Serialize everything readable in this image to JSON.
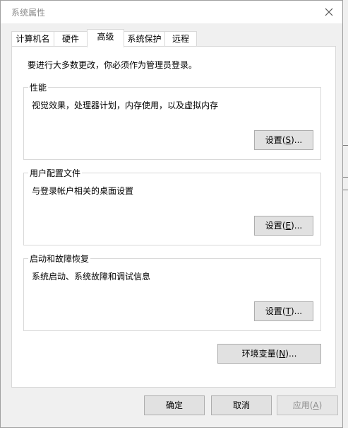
{
  "window": {
    "title": "系统属性"
  },
  "tabs": [
    {
      "label": "计算机名"
    },
    {
      "label": "硬件"
    },
    {
      "label": "高级"
    },
    {
      "label": "系统保护"
    },
    {
      "label": "远程"
    }
  ],
  "active_tab": "高级",
  "notice": "要进行大多数更改，你必须作为管理员登录。",
  "groups": {
    "performance": {
      "title": "性能",
      "description": "视觉效果，处理器计划，内存使用，以及虚拟内存",
      "button_prefix": "设置(",
      "button_key": "S",
      "button_suffix": ")..."
    },
    "profiles": {
      "title": "用户配置文件",
      "description": "与登录帐户相关的桌面设置",
      "button_prefix": "设置(",
      "button_key": "E",
      "button_suffix": ")..."
    },
    "startup": {
      "title": "启动和故障恢复",
      "description": "系统启动、系统故障和调试信息",
      "button_prefix": "设置(",
      "button_key": "T",
      "button_suffix": ")..."
    }
  },
  "env_button": {
    "prefix": "环境变量(",
    "key": "N",
    "suffix": ")..."
  },
  "footer": {
    "ok": "确定",
    "cancel": "取消",
    "apply_prefix": "应用(",
    "apply_key": "A",
    "apply_suffix": ")"
  }
}
